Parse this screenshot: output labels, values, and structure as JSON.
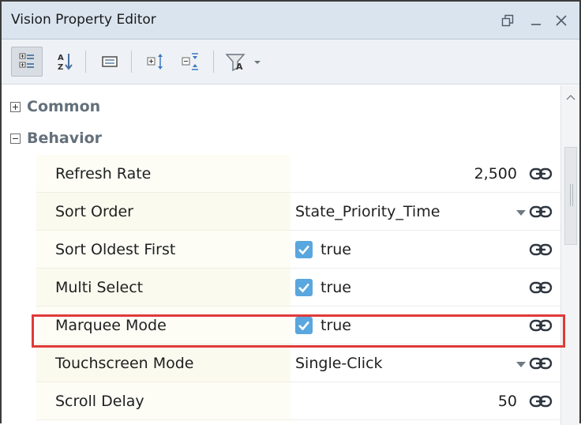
{
  "window": {
    "title": "Vision Property Editor",
    "restore_icon": "restore-window-icon",
    "minimize_icon": "minimize-icon",
    "close_icon": "close-icon"
  },
  "toolbar": {
    "buttons": [
      {
        "icon": "categorized-view-icon",
        "pressed": true
      },
      {
        "icon": "sort-alphabetical-icon",
        "pressed": false
      },
      {
        "icon": "property-description-icon",
        "pressed": false
      },
      {
        "icon": "expand-all-icon",
        "pressed": false
      },
      {
        "icon": "collapse-all-icon",
        "pressed": false
      },
      {
        "icon": "filter-properties-icon",
        "pressed": false
      }
    ]
  },
  "groups": [
    {
      "label": "Common",
      "expanded": false
    },
    {
      "label": "Behavior",
      "expanded": true
    }
  ],
  "properties": [
    {
      "name": "Refresh Rate",
      "value": "2,500",
      "kind": "number"
    },
    {
      "name": "Sort Order",
      "value": "State_Priority_Time",
      "kind": "dropdown"
    },
    {
      "name": "Sort Oldest First",
      "value": "true",
      "kind": "checkbox",
      "checked": true
    },
    {
      "name": "Multi Select",
      "value": "true",
      "kind": "checkbox",
      "checked": true
    },
    {
      "name": "Marquee Mode",
      "value": "true",
      "kind": "checkbox",
      "checked": true,
      "highlighted": true
    },
    {
      "name": "Touchscreen Mode",
      "value": "Single-Click",
      "kind": "dropdown"
    },
    {
      "name": "Scroll Delay",
      "value": "50",
      "kind": "number"
    }
  ],
  "colors": {
    "title_bar": "#dae4ee",
    "checkbox": "#5aa6de",
    "highlight_border": "#e03a3a",
    "group_label": "#64707b"
  }
}
